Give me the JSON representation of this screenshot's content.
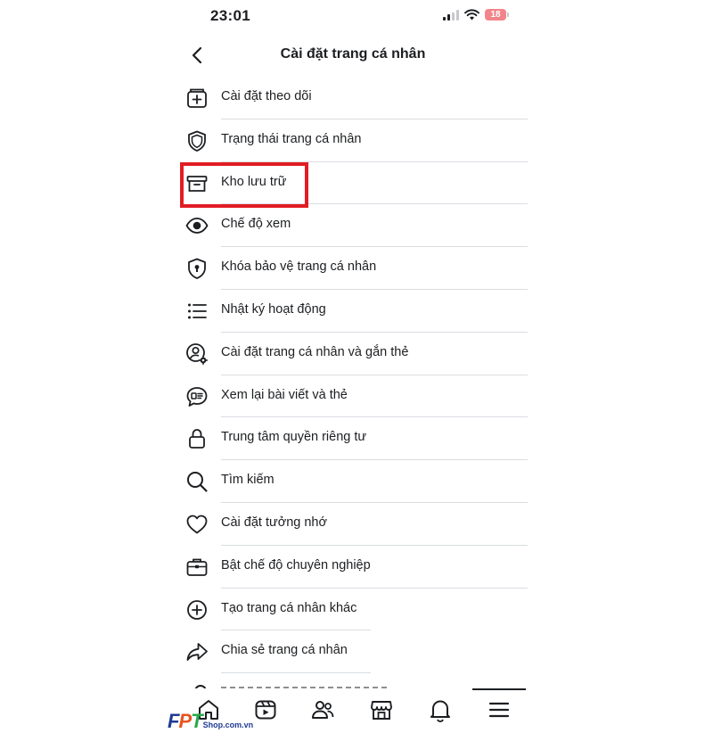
{
  "status_bar": {
    "time": "23:01",
    "battery": "18"
  },
  "header": {
    "title": "Cài đặt trang cá nhân",
    "back_icon": "chevron-left-icon"
  },
  "menu": {
    "items": [
      {
        "label": "Cài đặt theo dõi",
        "icon": "follow-settings-icon"
      },
      {
        "label": "Trạng thái trang cá nhân",
        "icon": "shield-icon"
      },
      {
        "label": "Kho lưu trữ",
        "icon": "archive-box-icon"
      },
      {
        "label": "Chế độ xem",
        "icon": "eye-icon"
      },
      {
        "label": "Khóa bảo vệ trang cá nhân",
        "icon": "shield-lock-icon"
      },
      {
        "label": "Nhật ký hoạt động",
        "icon": "list-icon"
      },
      {
        "label": "Cài đặt trang cá nhân và gắn thẻ",
        "icon": "user-gear-icon"
      },
      {
        "label": "Xem lại bài viết và thẻ",
        "icon": "post-review-icon"
      },
      {
        "label": "Trung tâm quyền riêng tư",
        "icon": "lock-icon"
      },
      {
        "label": "Tìm kiếm",
        "icon": "search-icon"
      },
      {
        "label": "Cài đặt tưởng nhớ",
        "icon": "heart-icon"
      },
      {
        "label": "Bật chế độ chuyên nghiệp",
        "icon": "briefcase-icon"
      },
      {
        "label": "Tạo trang cá nhân khác",
        "icon": "plus-circle-icon"
      },
      {
        "label": "Chia sẻ trang cá nhân",
        "icon": "share-arrow-icon"
      }
    ]
  },
  "highlight_color": "#e11d24",
  "tab_bar": {
    "tabs": [
      "home-icon",
      "video-icon",
      "friends-icon",
      "marketplace-icon",
      "bell-icon",
      "menu-icon"
    ]
  },
  "watermark": {
    "brand_f": "F",
    "brand_p": "P",
    "brand_t": "T",
    "brand_suffix": "Shop.com.vn"
  }
}
